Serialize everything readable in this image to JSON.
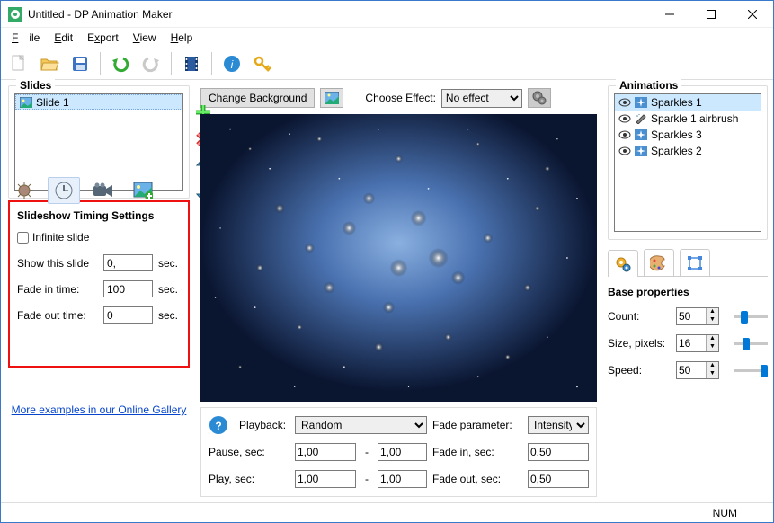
{
  "window": {
    "title": "Untitled - DP Animation Maker"
  },
  "menu": {
    "file": "File",
    "edit": "Edit",
    "export": "Export",
    "view": "View",
    "help": "Help"
  },
  "slides": {
    "label": "Slides",
    "items": [
      {
        "label": "Slide 1"
      }
    ]
  },
  "timing": {
    "header": "Slideshow Timing Settings",
    "infinite_label": "Infinite slide",
    "show_label": "Show this slide",
    "show_value": "0,",
    "fadein_label": "Fade in time:",
    "fadein_value": "100",
    "fadeout_label": "Fade out time:",
    "fadeout_value": "0",
    "sec": "sec."
  },
  "gallery_link": "More examples in our Online Gallery",
  "centerbar": {
    "change_bg": "Change Background",
    "choose_effect": "Choose Effect:",
    "effect_value": "No effect"
  },
  "playback": {
    "label": "Playback:",
    "mode": "Random",
    "pause_label": "Pause, sec:",
    "pause_min": "1,00",
    "pause_max": "1,00",
    "play_label": "Play, sec:",
    "play_min": "1,00",
    "play_max": "1,00",
    "fade_param_label": "Fade parameter:",
    "fade_param_value": "Intensity",
    "fadein_label": "Fade in, sec:",
    "fadein_value": "0,50",
    "fadeout_label": "Fade out, sec:",
    "fadeout_value": "0,50",
    "dash": "-"
  },
  "animations": {
    "label": "Animations",
    "items": [
      {
        "label": "Sparkles 1",
        "selected": true,
        "brush": false
      },
      {
        "label": "Sparkle 1 airbrush",
        "selected": false,
        "brush": true
      },
      {
        "label": "Sparkles 3",
        "selected": false,
        "brush": false
      },
      {
        "label": "Sparkles 2",
        "selected": false,
        "brush": false
      }
    ]
  },
  "props": {
    "header": "Base properties",
    "count_label": "Count:",
    "count_value": "50",
    "size_label": "Size, pixels:",
    "size_value": "16",
    "speed_label": "Speed:",
    "speed_value": "50"
  },
  "statusbar": {
    "num": "NUM"
  }
}
